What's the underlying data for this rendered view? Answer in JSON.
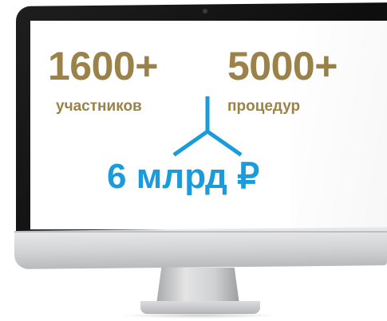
{
  "stats": {
    "participants_number": "1600+",
    "participants_label": "участников",
    "procedures_number": "5000+",
    "procedures_label": "процедур",
    "total": "6 млрд ₽"
  },
  "colors": {
    "gold": "#9a8248",
    "blue": "#1a9bdc",
    "bezel": "#111111"
  },
  "icons": {
    "connector": "tri-branch-icon"
  }
}
